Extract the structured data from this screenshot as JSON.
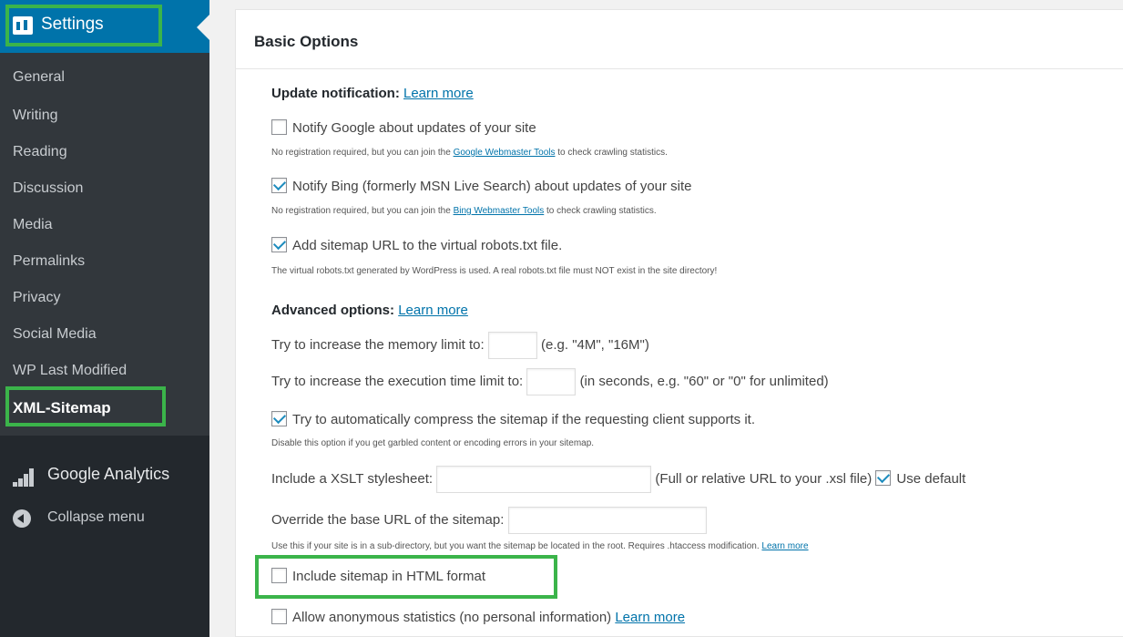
{
  "sidebar": {
    "active_menu": "Settings",
    "submenu": [
      "General",
      "Writing",
      "Reading",
      "Discussion",
      "Media",
      "Permalinks",
      "Privacy",
      "Social Media",
      "WP Last Modified",
      "XML-Sitemap"
    ],
    "google_analytics": "Google Analytics",
    "collapse": "Collapse menu"
  },
  "main": {
    "title": "Basic Options",
    "update_heading": "Update notification:",
    "update_link": "Learn more",
    "notify_google": {
      "label": "Notify Google about updates of your site",
      "checked": false,
      "desc_prefix": "No registration required, but you can join the ",
      "desc_link": "Google Webmaster Tools",
      "desc_suffix": " to check crawling statistics."
    },
    "notify_bing": {
      "label": "Notify Bing (formerly MSN Live Search) about updates of your site",
      "checked": true,
      "desc_prefix": "No registration required, but you can join the ",
      "desc_link": "Bing Webmaster Tools",
      "desc_suffix": " to check crawling statistics."
    },
    "robots": {
      "label": "Add sitemap URL to the virtual robots.txt file.",
      "checked": true,
      "desc": "The virtual robots.txt generated by WordPress is used. A real robots.txt file must NOT exist in the site directory!"
    },
    "advanced_heading": "Advanced options:",
    "advanced_link": "Learn more",
    "memory": {
      "label": "Try to increase the memory limit to:",
      "hint": "(e.g. \"4M\", \"16M\")",
      "value": ""
    },
    "exec_time": {
      "label": "Try to increase the execution time limit to:",
      "hint": "(in seconds, e.g. \"60\" or \"0\" for unlimited)",
      "value": ""
    },
    "compress": {
      "label": "Try to automatically compress the sitemap if the requesting client supports it.",
      "checked": true,
      "desc": "Disable this option if you get garbled content or encoding errors in your sitemap."
    },
    "xslt": {
      "label": "Include a XSLT stylesheet:",
      "value": "",
      "hint": "(Full or relative URL to your .xsl file)",
      "use_default": "Use default",
      "use_default_checked": true
    },
    "base_url": {
      "label": "Override the base URL of the sitemap:",
      "value": "",
      "desc": "Use this if your site is in a sub-directory, but you want the sitemap be located in the root. Requires .htaccess modification. ",
      "desc_link": "Learn more"
    },
    "html_format": {
      "label": "Include sitemap in HTML format",
      "checked": false
    },
    "anon_stats": {
      "label": "Allow anonymous statistics (no personal information)",
      "link": "Learn more",
      "checked": false
    }
  },
  "colors": {
    "sidebar_bg": "#23282d",
    "submenu_bg": "#32373c",
    "active_blue": "#0073aa",
    "highlight_green": "#3bb44a",
    "link": "#0073aa"
  },
  "icons": {
    "settings": "settings-icon",
    "google_analytics": "bar-chart-icon",
    "collapse": "collapse-arrow-icon"
  }
}
